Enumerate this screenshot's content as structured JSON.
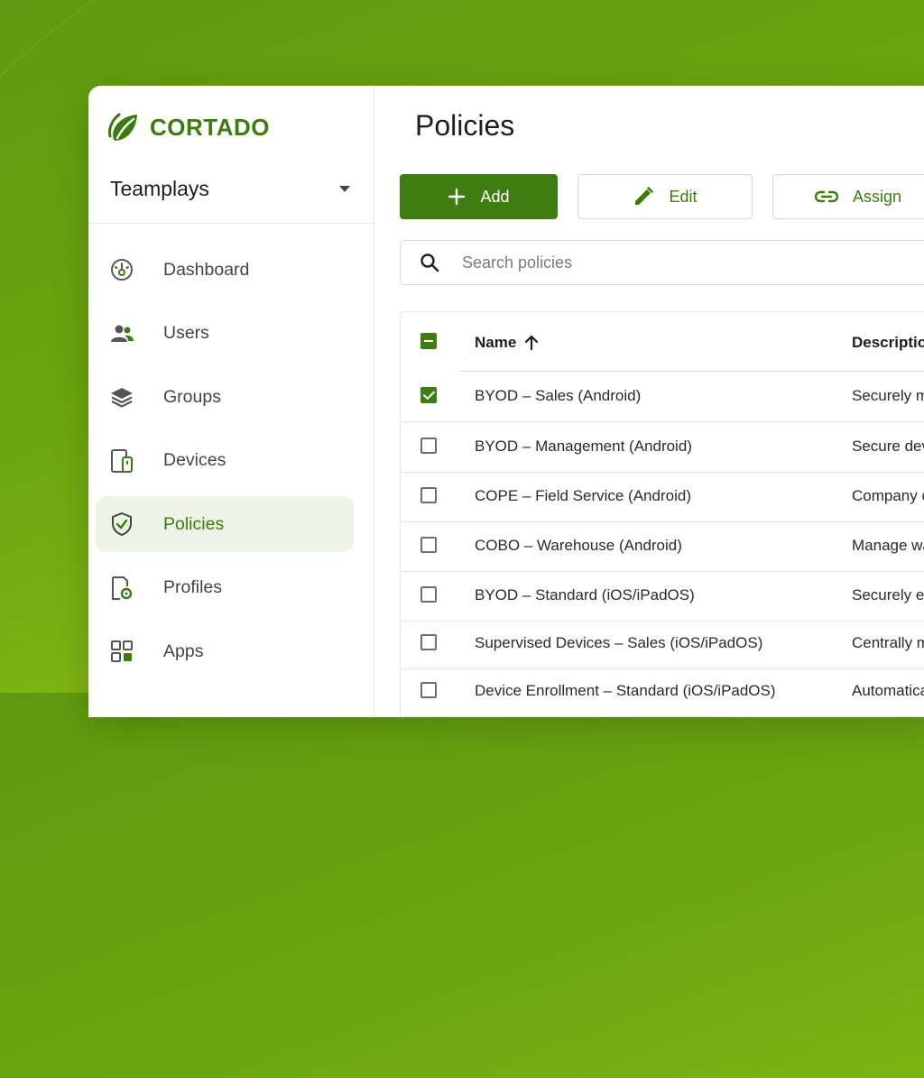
{
  "brand": {
    "name": "CORTADO",
    "color": "#3a7d0d"
  },
  "tenant": {
    "name": "Teamplays"
  },
  "nav": [
    {
      "label": "Dashboard",
      "icon": "dashboard-gauge-icon",
      "active": false
    },
    {
      "label": "Users",
      "icon": "users-icon",
      "active": false
    },
    {
      "label": "Groups",
      "icon": "layers-icon",
      "active": false
    },
    {
      "label": "Devices",
      "icon": "devices-icon",
      "active": false
    },
    {
      "label": "Policies",
      "icon": "shield-check-icon",
      "active": true
    },
    {
      "label": "Profiles",
      "icon": "profile-gear-icon",
      "active": false
    },
    {
      "label": "Apps",
      "icon": "apps-grid-icon",
      "active": false
    }
  ],
  "page": {
    "title": "Policies"
  },
  "toolbar": {
    "add_label": "Add",
    "edit_label": "Edit",
    "assign_label": "Assign"
  },
  "search": {
    "placeholder": "Search policies",
    "value": ""
  },
  "table": {
    "columns": {
      "name": "Name",
      "description": "Descriptio",
      "sort": "ascending"
    },
    "rows": [
      {
        "name": "BYOD – Sales (Android)",
        "description": "Securely m",
        "checked": true
      },
      {
        "name": "BYOD – Management (Android)",
        "description": "Secure dev",
        "checked": false
      },
      {
        "name": "COPE – Field Service (Android)",
        "description": "Company c",
        "checked": false
      },
      {
        "name": "COBO – Warehouse (Android)",
        "description": "Manage wa",
        "checked": false
      },
      {
        "name": "BYOD – Standard (iOS/iPadOS)",
        "description": "Securely en",
        "checked": false
      },
      {
        "name": "Supervised Devices – Sales (iOS/iPadOS)",
        "description": "Centrally m",
        "checked": false
      },
      {
        "name": "Device Enrollment – Standard (iOS/iPadOS)",
        "description": "Automatica",
        "checked": false
      }
    ]
  },
  "colors": {
    "accent": "#3f7d13",
    "active_bg": "#edf4e5",
    "background": "#6aa40f"
  }
}
